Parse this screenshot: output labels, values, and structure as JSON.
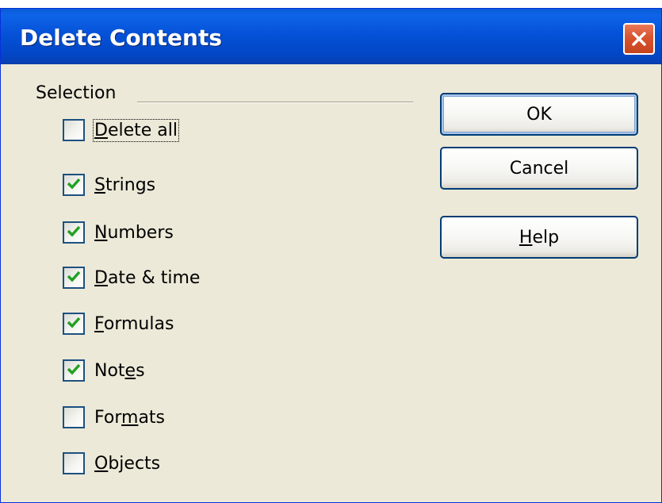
{
  "window": {
    "title": "Delete Contents"
  },
  "icons": {
    "close": "close-icon",
    "check": "checkmark-icon"
  },
  "colors": {
    "title_bar": "#0552d8",
    "close_button": "#d9532e",
    "dialog_background": "#ece9d8",
    "checkmark": "#21a121",
    "button_border": "#003c74"
  },
  "selection": {
    "label": "Selection",
    "items": [
      {
        "pre": "",
        "key": "D",
        "post": "elete all",
        "checked": false
      },
      {
        "pre": "",
        "key": "S",
        "post": "trings",
        "checked": true
      },
      {
        "pre": "",
        "key": "N",
        "post": "umbers",
        "checked": true
      },
      {
        "pre": "",
        "key": "D",
        "post": "ate & time",
        "checked": true
      },
      {
        "pre": "",
        "key": "F",
        "post": "ormulas",
        "checked": true
      },
      {
        "pre": "Not",
        "key": "e",
        "post": "s",
        "checked": true
      },
      {
        "pre": "For",
        "key": "m",
        "post": "ats",
        "checked": false
      },
      {
        "pre": "",
        "key": "O",
        "post": "bjects",
        "checked": false
      }
    ]
  },
  "buttons": {
    "ok": {
      "label": "OK"
    },
    "cancel": {
      "label": "Cancel"
    },
    "help": {
      "pre": "",
      "key": "H",
      "post": "elp"
    }
  }
}
